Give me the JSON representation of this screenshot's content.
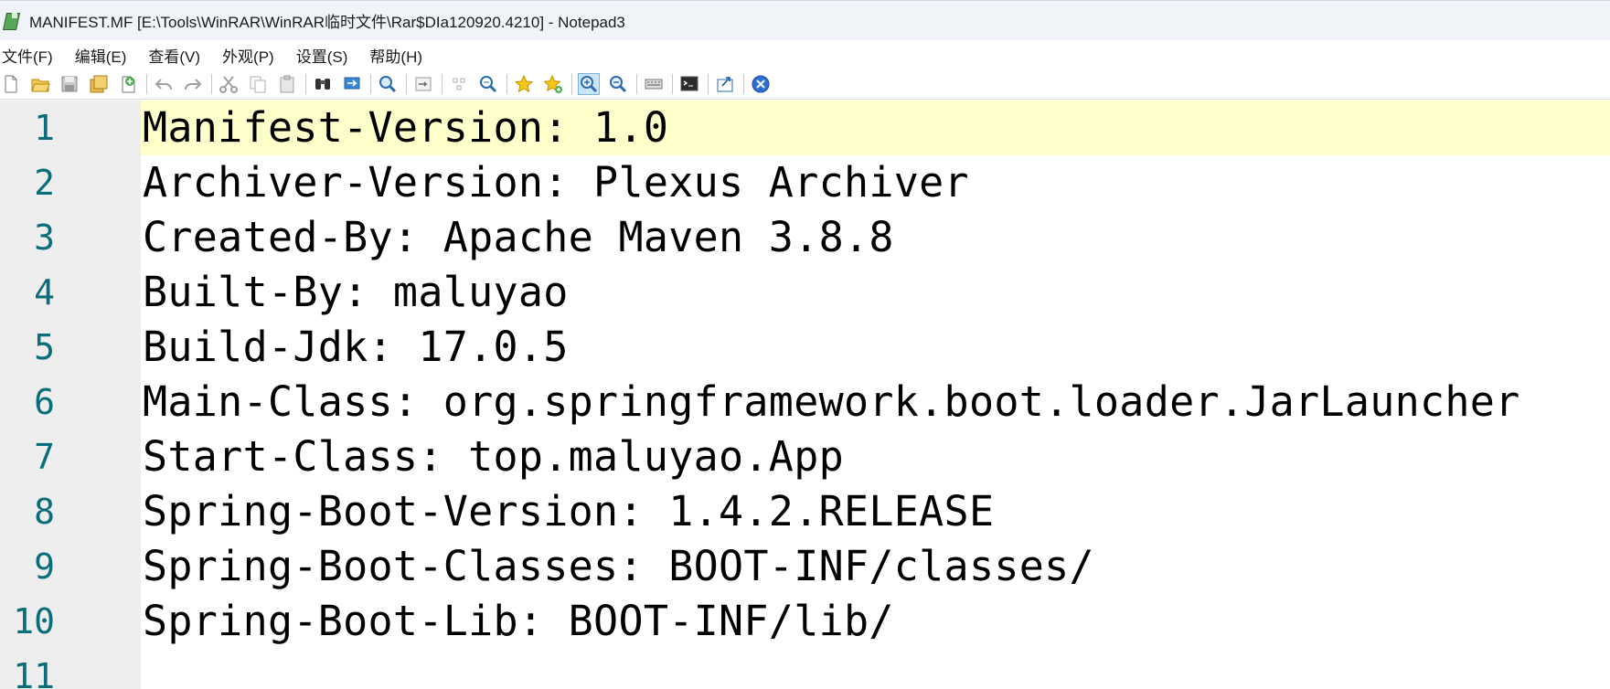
{
  "window": {
    "title": "MANIFEST.MF [E:\\Tools\\WinRAR\\WinRAR临时文件\\Rar$DIa120920.4210] - Notepad3",
    "app_icon": "notepad3-icon"
  },
  "menu": {
    "items": [
      "文件(F)",
      "编辑(E)",
      "查看(V)",
      "外观(P)",
      "设置(S)",
      "帮助(H)"
    ]
  },
  "toolbar": {
    "buttons": [
      "new-file-icon",
      "open-folder-icon",
      "save-icon",
      "save-as-icon",
      "reload-icon",
      "undo-icon",
      "redo-icon",
      "cut-icon",
      "copy-icon",
      "paste-icon",
      "find-icon",
      "replace-icon",
      "find-in-files-icon",
      "word-wrap-icon",
      "select-all-icon",
      "goto-icon",
      "favorite-icon",
      "add-favorite-icon",
      "zoom-in-icon",
      "zoom-out-icon",
      "scheme-icon",
      "terminal-icon",
      "send-to-icon",
      "close-icon"
    ],
    "active_button": "zoom-in-icon"
  },
  "editor": {
    "current_line_color": "#ffffcc",
    "line_number_color": "#0a6d7c",
    "lines": [
      {
        "num": "1",
        "text": "Manifest-Version: 1.0"
      },
      {
        "num": "2",
        "text": "Archiver-Version: Plexus Archiver"
      },
      {
        "num": "3",
        "text": "Created-By: Apache Maven 3.8.8"
      },
      {
        "num": "4",
        "text": "Built-By: maluyao"
      },
      {
        "num": "5",
        "text": "Build-Jdk: 17.0.5"
      },
      {
        "num": "6",
        "text": "Main-Class: org.springframework.boot.loader.JarLauncher"
      },
      {
        "num": "7",
        "text": "Start-Class: top.maluyao.App"
      },
      {
        "num": "8",
        "text": "Spring-Boot-Version: 1.4.2.RELEASE"
      },
      {
        "num": "9",
        "text": "Spring-Boot-Classes: BOOT-INF/classes/"
      },
      {
        "num": "10",
        "text": "Spring-Boot-Lib: BOOT-INF/lib/"
      },
      {
        "num": "11",
        "text": ""
      }
    ]
  }
}
